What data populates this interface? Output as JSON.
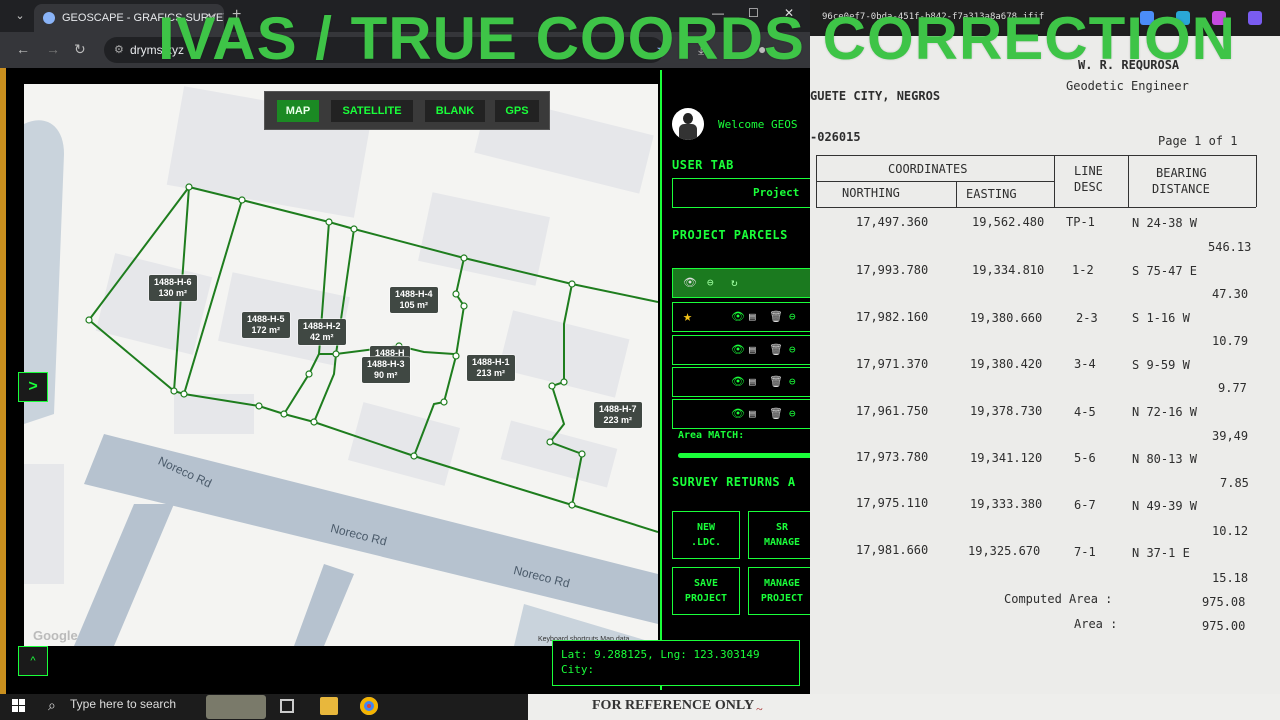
{
  "browser": {
    "tab_title": "GEOSCAPE - GRAFICS SURVEY",
    "url": "dryms.xyz"
  },
  "overlay_title": "IVAS / TRUE COORDS CORRECTION",
  "map": {
    "toggles": [
      "MAP",
      "SATELLITE",
      "BLANK",
      "GPS"
    ],
    "active_toggle": "MAP",
    "road_labels": [
      "Noreco Rd",
      "Noreco Rd",
      "Noreco Rd"
    ],
    "google_logo": "Google",
    "keyboard_shortcuts": "Keyboard shortcuts  Map data",
    "parcels": [
      {
        "id": "1488-H-6",
        "area": "130 m²"
      },
      {
        "id": "1488-H-5",
        "area": "172 m²"
      },
      {
        "id": "1488-H-2",
        "area": "42 m²"
      },
      {
        "id": "1488-H-4",
        "area": "105 m²"
      },
      {
        "id": "1488-H",
        "area": ""
      },
      {
        "id": "1488-H-3",
        "area": "90 m²"
      },
      {
        "id": "1488-H-1",
        "area": "213 m²"
      },
      {
        "id": "1488-H-7",
        "area": "223 m²"
      }
    ],
    "expand_right": ">",
    "expand_up": "^"
  },
  "coords_readout": {
    "line1": "Lat: 9.288125, Lng: 123.303149",
    "line2": "City:"
  },
  "panel": {
    "welcome": "Welcome GEOS",
    "user_tab": "USER TAB",
    "project_button": "Project",
    "project_parcels": "PROJECT PARCELS",
    "area_match": "Area MATCH:",
    "area_match_fill": 0.98,
    "survey_returns": "SURVEY RETURNS A",
    "buttons": {
      "new_ldc": "NEW\n.LDC.",
      "sr_manage": "SR\nMANAGE",
      "save_project": "SAVE\nPROJECT",
      "manage_project": "MANAGE\nPROJECT"
    }
  },
  "document": {
    "file_name": "96ce0ef7-0bda-451f-b842-f7a313a8a678.jfif",
    "engineer_name": "W. R. REQUROSA",
    "engineer_title": "Geodetic Engineer",
    "city": "GUETE CITY, NEGROS",
    "doc_no": "-026015",
    "page": "Page 1 of 1",
    "headers": {
      "coordinates": "COORDINATES",
      "northing": "NORTHING",
      "easting": "EASTING",
      "line": "LINE",
      "desc": "DESC",
      "bearing": "BEARING",
      "distance": "DISTANCE"
    },
    "rows": [
      {
        "n": "17,497.360",
        "e": "19,562.480",
        "line": "TP-1",
        "bearing": "N 24-38 W",
        "distance": "546.13"
      },
      {
        "n": "17,993.780",
        "e": "19,334.810",
        "line": "1-2",
        "bearing": "S 75-47 E",
        "distance": "47.30"
      },
      {
        "n": "17,982.160",
        "e": "19,380.660",
        "line": "2-3",
        "bearing": "S 1-16 W",
        "distance": "10.79"
      },
      {
        "n": "17,971.370",
        "e": "19,380.420",
        "line": "3-4",
        "bearing": "S 9-59 W",
        "distance": "9.77"
      },
      {
        "n": "17,961.750",
        "e": "19,378.730",
        "line": "4-5",
        "bearing": "N 72-16 W",
        "distance": "39,49"
      },
      {
        "n": "17,973.780",
        "e": "19,341.120",
        "line": "5-6",
        "bearing": "N 80-13 W",
        "distance": "7.85"
      },
      {
        "n": "17,975.110",
        "e": "19,333.380",
        "line": "6-7",
        "bearing": "N 49-39 W",
        "distance": "10.12"
      },
      {
        "n": "17,981.660",
        "e": "19,325.670",
        "line": "7-1",
        "bearing": "N 37-1 E",
        "distance": "15.18"
      }
    ],
    "computed_area_label": "Computed Area :",
    "computed_area": "975.08",
    "area_label": "Area :",
    "area": "975.00",
    "for_reference": "FOR REFERENCE ONLY"
  },
  "taskbar": {
    "search_placeholder": "Type here to search"
  },
  "colors": {
    "accent": "#1aff3a",
    "active_toggle": "#1b8a23",
    "title": "#3ec447",
    "parcel_line": "#1e7d1e"
  }
}
